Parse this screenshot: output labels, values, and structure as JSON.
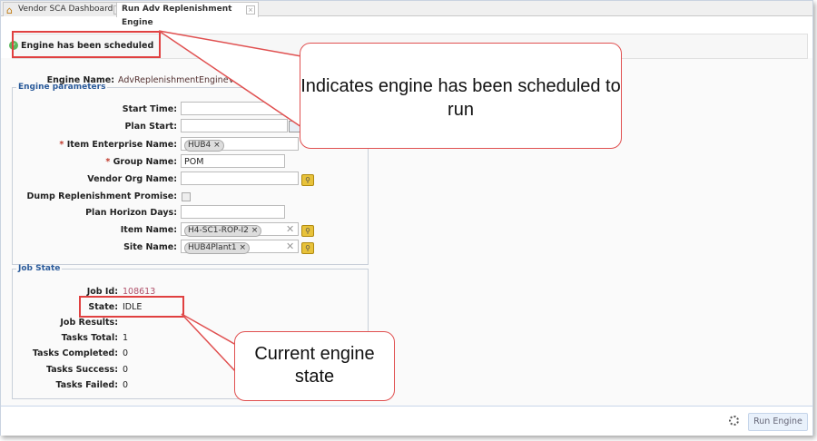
{
  "tabs": [
    {
      "label": "Vendor SCA Dashboard",
      "icon": "home-icon"
    },
    {
      "label": "Run Adv Replenishment Engine"
    }
  ],
  "message": "Engine has been scheduled",
  "engine_name": {
    "label": "Engine Name:",
    "value": "AdvReplenishmentEngineVMI"
  },
  "engine_parameters": {
    "legend": "Engine parameters",
    "start_time": {
      "label": "Start Time:",
      "value": ""
    },
    "plan_start": {
      "label": "Plan Start:",
      "value": ""
    },
    "item_enterprise_name": {
      "label": "Item Enterprise Name:",
      "chip": "HUB4"
    },
    "group_name": {
      "label": "Group Name:",
      "value": "POM"
    },
    "vendor_org_name": {
      "label": "Vendor Org Name:",
      "value": ""
    },
    "dump_replenishment_promise": {
      "label": "Dump Replenishment Promise:",
      "checked": false
    },
    "plan_horizon_days": {
      "label": "Plan Horizon Days:",
      "value": ""
    },
    "item_name": {
      "label": "Item Name:",
      "chip": "H4-SC1-ROP-I2"
    },
    "site_name": {
      "label": "Site Name:",
      "chip": "HUB4Plant1"
    },
    "required_mark": "*"
  },
  "job_state": {
    "legend": "Job State",
    "job_id": {
      "label": "Job Id:",
      "value": "108613"
    },
    "state": {
      "label": "State:",
      "value": "IDLE"
    },
    "job_results": {
      "label": "Job Results:",
      "value": ""
    },
    "tasks_total": {
      "label": "Tasks Total:",
      "value": "1"
    },
    "tasks_completed": {
      "label": "Tasks Completed:",
      "value": "0"
    },
    "tasks_success": {
      "label": "Tasks Success:",
      "value": "0"
    },
    "tasks_failed": {
      "label": "Tasks Failed:",
      "value": "0"
    }
  },
  "footer": {
    "run_engine": "Run Engine"
  },
  "callouts": {
    "scheduled": "Indicates engine has been scheduled to run",
    "state": "Current engine state"
  },
  "colors": {
    "callout_border": "#e05050",
    "legend": "#2a5a9a",
    "job_id": "#b0506a"
  }
}
